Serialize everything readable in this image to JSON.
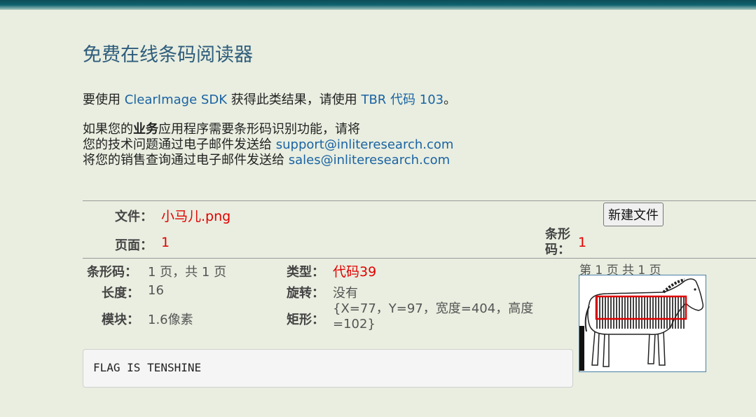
{
  "title": "免费在线条码阅读器",
  "intro": {
    "prefix": "要使用 ",
    "sdk_link": "ClearImage SDK",
    "middle": " 获得此类结果，请使用 ",
    "code_link": "TBR 代码 103",
    "suffix": "。"
  },
  "business": {
    "line1_a": "如果您的",
    "line1_bold": "业务",
    "line1_b": "应用程序需要条形码识别功能，请将",
    "line2_text": "您的技术问题通过电子邮件发送给 ",
    "support_email": "support@inliteresearch.com",
    "line3_text": "将您的销售查询通过电子邮件发送给 ",
    "sales_email": "sales@inliteresearch.com"
  },
  "file": {
    "file_label": "文件：",
    "file_name": "小马儿.png",
    "page_label": "页面：",
    "page_value": "1",
    "barcode_count_label": "条形码：",
    "barcode_count_value": "1",
    "new_file_button": "新建文件"
  },
  "result": {
    "barcode_label": "条形码：",
    "barcode_value": "1 页，共 1 页",
    "type_label": "类型：",
    "type_value": "代码39",
    "length_label": "长度：",
    "length_value": "16",
    "rotation_label": "旋转：",
    "rotation_value": "没有",
    "module_label": "模块：",
    "module_value": "1.6像素",
    "rect_label": "矩形：",
    "rect_value": "{X=77，Y=97，宽度=404，高度=102}",
    "decoded_text": "FLAG IS TENSHINE"
  },
  "thumbnail": {
    "caption": "第 1 页 共 1 页",
    "subject": "zebra",
    "highlight_color": "#e00000"
  }
}
